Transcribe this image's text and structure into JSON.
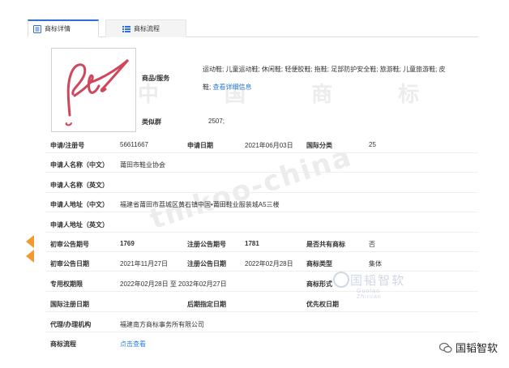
{
  "tabs": [
    {
      "label": "商标详情"
    },
    {
      "label": "商标流程"
    }
  ],
  "goods_label": "商品/服务",
  "goods_line1": "运动鞋; 儿童运动鞋; 休闲鞋; 轻便胶鞋; 拖鞋; 足部防护安全鞋; 旅游鞋; 儿童旅游鞋; 皮",
  "goods_line2": "鞋;",
  "goods_link": "查看详细信息",
  "group_label": "类似群",
  "group_value": "2507;",
  "rows": {
    "reg_no_label": "申请/注册号",
    "reg_no": "56611667",
    "apply_date_label": "申请日期",
    "apply_date": "2021年06月03日",
    "class_label": "国际分类",
    "class_value": "25",
    "applicant_cn_label": "申请人名称（中文）",
    "applicant_cn": "莆田市鞋业协会",
    "applicant_en_label": "申请人名称（英文）",
    "addr_cn_label": "申请人地址（中文）",
    "addr_cn": "福建省莆田市荔城区黄石镇中国•莆田鞋业服装城A5三楼",
    "addr_en_label": "申请人地址（英文）",
    "prelim_no_label": "初审公告期号",
    "prelim_no": "1769",
    "reg_pub_no_label": "注册公告期号",
    "reg_pub_no": "1781",
    "shared_label": "是否共有商标",
    "shared_value": "否",
    "prelim_date_label": "初审公告日期",
    "prelim_date": "2021年11月27日",
    "reg_pub_date_label": "注册公告日期",
    "reg_pub_date": "2022年02月28日",
    "type_label": "商标类型",
    "type_value": "集体",
    "period_label": "专用权期限",
    "period_value": "2022年02月28日 至 2032年02月27日",
    "form_label": "商标形式",
    "intl_date_label": "国际注册日期",
    "later_date_label": "后期指定日期",
    "priority_label": "优先权日期",
    "agent_label": "代理/办理机构",
    "agent_value": "福建南方商标事务所有限公司",
    "flow_label": "商标流程",
    "flow_link": "点击查看"
  },
  "watermark": {
    "text1": "tmkoo-china",
    "cn": "中 国 商 标"
  },
  "overlay_mark": {
    "text": "国韬智软",
    "sub": "Guotao Zhiruan"
  },
  "brand": "国韬智软",
  "colors": {
    "accent": "#2f6fd6",
    "link": "#2f7fd6",
    "badge": "#f29a2e"
  }
}
